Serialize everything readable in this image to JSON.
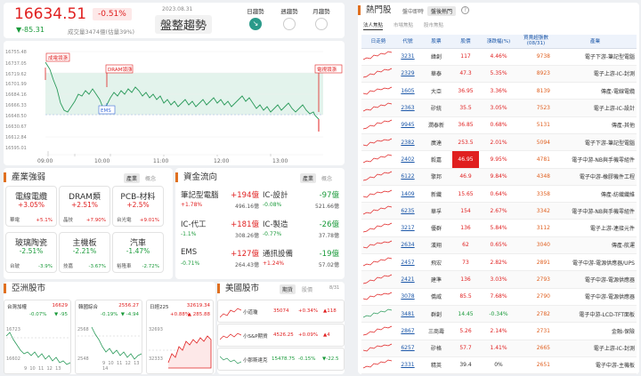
{
  "header": {
    "price": "16634.51",
    "pct": "-0.51%",
    "change": "▼-85.31",
    "volume": "成交量3474億(估量39%)",
    "date": "2023.08.31",
    "trend": "盤整趨勢",
    "trend_buttons": [
      "日趨勢",
      "週趨勢",
      "月趨勢"
    ]
  },
  "main_chart": {
    "y_ticks": [
      "16755.48",
      "16737.05",
      "16719.62",
      "16701.99",
      "16684.16",
      "16666.33",
      "16648.50",
      "16630.67",
      "16612.84",
      "16595.01"
    ],
    "x_ticks": [
      "09:00",
      "10:00",
      "11:00",
      "12:00",
      "13:00"
    ],
    "annotations": [
      "成電領漲",
      "DRAM領漲",
      "EMS",
      "電視領漲"
    ]
  },
  "industry": {
    "title": "產業強弱",
    "tabs": [
      "產業",
      "概念"
    ],
    "cards": [
      {
        "title": "電線電纜",
        "pct": "+3.05%",
        "sub": "華電",
        "sub_pct": "+5.1%"
      },
      {
        "title": "DRAM類",
        "pct": "+2.51%",
        "sub": "晶技",
        "sub_pct": "+7.90%"
      },
      {
        "title": "PCB-材料",
        "pct": "+2.5%",
        "sub": "台光電",
        "sub_pct": "+9.01%"
      },
      {
        "title": "玻璃陶瓷",
        "pct": "-2.51%",
        "sub": "台玻",
        "sub_pct": "-3.9%"
      },
      {
        "title": "主機板",
        "pct": "-2.21%",
        "sub": "技嘉",
        "sub_pct": "-3.67%"
      },
      {
        "title": "汽車",
        "pct": "-1.47%",
        "sub": "裕隆車",
        "sub_pct": "-2.72%"
      }
    ]
  },
  "flow": {
    "title": "資金流向",
    "tabs": [
      "產業",
      "概念"
    ],
    "items": [
      {
        "name": "筆記型電腦",
        "value": "+194億",
        "pct": "+1.78%",
        "amt": "496.16億"
      },
      {
        "name": "IC-設計",
        "value": "-97億",
        "pct": "-0.08%",
        "amt": "521.66億"
      },
      {
        "name": "IC-代工",
        "value": "+181億",
        "pct": "-1.1%",
        "amt": "308.26億"
      },
      {
        "name": "IC-製造",
        "value": "-26億",
        "pct": "-0.77%",
        "amt": "37.78億"
      },
      {
        "name": "EMS",
        "value": "+127億",
        "pct": "-0.71%",
        "amt": "264.43億"
      },
      {
        "name": "通訊設備",
        "value": "-19億",
        "pct": "+1.24%",
        "amt": "57.02億"
      }
    ]
  },
  "asia": {
    "title": "亞洲股市",
    "markets": [
      {
        "name": "台灣加權",
        "value": "16629",
        "pct": "-0.07%",
        "chg": "▼ -95",
        "lo": "16602",
        "hi": "16723"
      },
      {
        "name": "韓國綜合",
        "value": "2556.27",
        "pct": "-0.19%",
        "chg": "▼ -4.94",
        "lo": "2548",
        "hi": "2568"
      },
      {
        "name": "日經225",
        "value": "32619.34",
        "pct": "+0.88%",
        "chg": "▲ 285.88",
        "lo": "32333",
        "hi": "32693"
      }
    ],
    "x_ticks": [
      "9",
      "10",
      "11",
      "12",
      "13",
      "14"
    ]
  },
  "us": {
    "title": "美國股市",
    "tabs": [
      "期貨",
      "股價"
    ],
    "time": "8/31",
    "rows": [
      {
        "name": "小道瓊",
        "value": "35074",
        "pct": "+0.34%",
        "chg": "▲118"
      },
      {
        "name": "小S&P期貨",
        "value": "4526.25",
        "pct": "+0.09%",
        "chg": "▲4"
      },
      {
        "name": "小那斯達克",
        "value": "15478.75",
        "pct": "-0.15%",
        "chg": "▼-22.5"
      }
    ]
  },
  "hot": {
    "title": "熱門股",
    "tabs": [
      "盤中即時",
      "盤後熱門"
    ],
    "subtabs": [
      "法人焦點",
      "市場焦點",
      "股市焦點"
    ],
    "columns": [
      "日走勢",
      "代號",
      "股票",
      "股價",
      "漲跌幅(%)",
      "買賣超張數(08/31)",
      "產業"
    ],
    "rows": [
      {
        "code": "3231",
        "name": "緯創",
        "price": "117",
        "pct": "4.46%",
        "vol": "9738",
        "ind": "電子下游-筆記型電腦"
      },
      {
        "code": "2329",
        "name": "華泰",
        "price": "47.3",
        "pct": "5.35%",
        "vol": "8923",
        "ind": "電子上游-IC-封測"
      },
      {
        "code": "1605",
        "name": "大亞",
        "price": "36.95",
        "pct": "3.36%",
        "vol": "8139",
        "ind": "傳產-電線電纜"
      },
      {
        "code": "2363",
        "name": "矽統",
        "price": "35.5",
        "pct": "3.05%",
        "vol": "7523",
        "ind": "電子上游-IC-設計"
      },
      {
        "code": "9945",
        "name": "潤泰新",
        "price": "36.85",
        "pct": "0.68%",
        "vol": "5131",
        "ind": "傳產-其他"
      },
      {
        "code": "2382",
        "name": "廣達",
        "price": "253.5",
        "pct": "2.01%",
        "vol": "5094",
        "ind": "電子下游-筆記型電腦"
      },
      {
        "code": "2402",
        "name": "毅嘉",
        "price": "46.95",
        "pct": "9.95%",
        "vol": "4781",
        "ind": "電子中游-NB與手機零組件",
        "hl": true
      },
      {
        "code": "6122",
        "name": "擎邦",
        "price": "46.9",
        "pct": "9.84%",
        "vol": "4348",
        "ind": "電子中游-橡膠機件工程"
      },
      {
        "code": "1409",
        "name": "新纖",
        "price": "15.65",
        "pct": "0.64%",
        "vol": "3358",
        "ind": "傳產-紡織纖維"
      },
      {
        "code": "6235",
        "name": "華孚",
        "price": "154",
        "pct": "2.67%",
        "vol": "3342",
        "ind": "電子中游-NB與手機零組件"
      },
      {
        "code": "3217",
        "name": "優群",
        "price": "136",
        "pct": "5.84%",
        "vol": "3112",
        "ind": "電子上游-連接元件"
      },
      {
        "code": "2634",
        "name": "漢翔",
        "price": "62",
        "pct": "0.65%",
        "vol": "3040",
        "ind": "傳產-航運"
      },
      {
        "code": "2457",
        "name": "飛宏",
        "price": "73",
        "pct": "2.82%",
        "vol": "2891",
        "ind": "電子中游-電源供應器/UPS"
      },
      {
        "code": "2421",
        "name": "建準",
        "price": "136",
        "pct": "3.03%",
        "vol": "2793",
        "ind": "電子中游-電源供應器"
      },
      {
        "code": "3078",
        "name": "僑威",
        "price": "85.5",
        "pct": "7.68%",
        "vol": "2790",
        "ind": "電子中游-電源供應器"
      },
      {
        "code": "3481",
        "name": "群創",
        "price": "14.45",
        "pct": "-0.34%",
        "vol": "2782",
        "ind": "電子中游-LCD-TFT面板"
      },
      {
        "code": "2867",
        "name": "三商壽",
        "price": "5.26",
        "pct": "2.14%",
        "vol": "2731",
        "ind": "金融-保險"
      },
      {
        "code": "6257",
        "name": "矽格",
        "price": "57.7",
        "pct": "1.41%",
        "vol": "2665",
        "ind": "電子上游-IC-封測"
      },
      {
        "code": "2331",
        "name": "精英",
        "price": "39.4",
        "pct": "0%",
        "vol": "2651",
        "ind": "電子中游-主機板"
      }
    ]
  }
}
